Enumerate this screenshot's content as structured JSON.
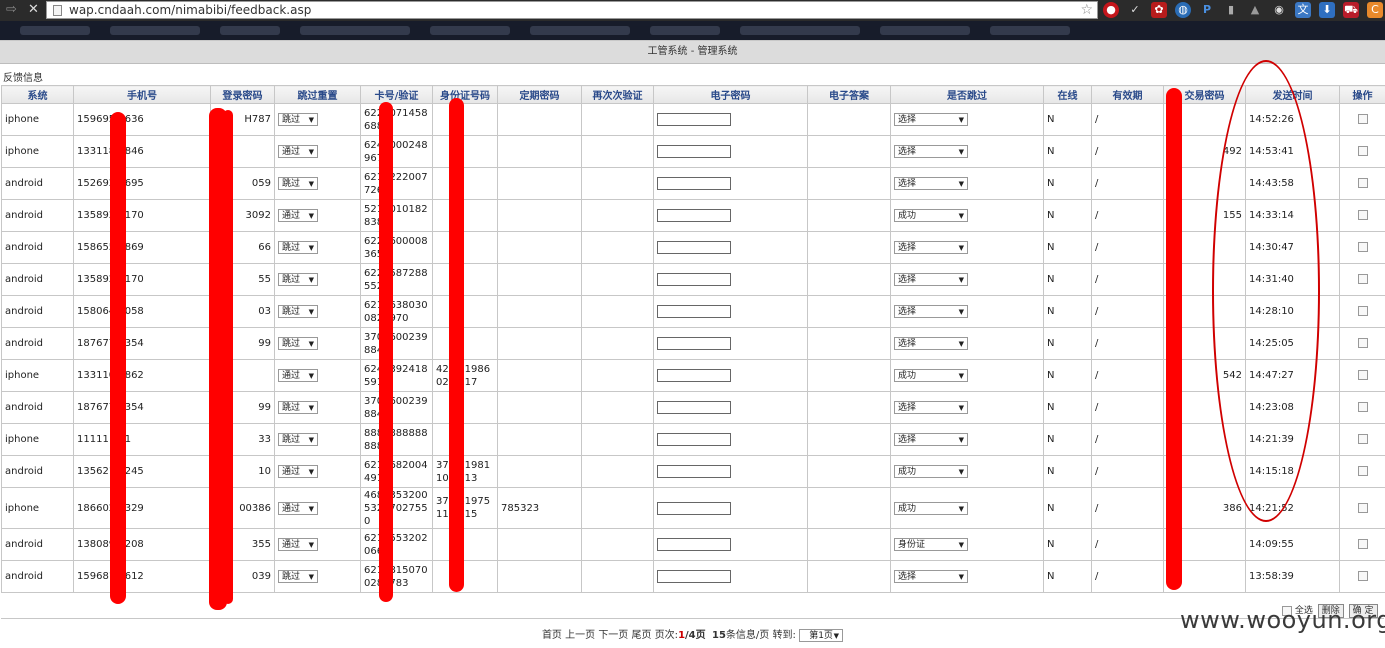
{
  "browser": {
    "url": "wap.cndaah.com/nimabibi/feedback.asp",
    "extensions": [
      "stop-icon",
      "check-icon",
      "paw-icon",
      "firefox-icon",
      "p-icon",
      "bag-icon",
      "globe-icon",
      "translate-icon",
      "download-icon",
      "car-icon",
      "c-icon"
    ]
  },
  "app": {
    "title": "工管系统 - 管理系统",
    "section": "反馈信息"
  },
  "table": {
    "headers": [
      "系统",
      "手机号",
      "登录密码",
      "跳过重置",
      "卡号/验证",
      "身份证号码",
      "定期密码",
      "再次次验证",
      "电子密码",
      "电子答案",
      "是否跳过",
      "在线",
      "有效期",
      "交易密码",
      "发送时间",
      "操作"
    ],
    "rows": [
      {
        "system": "iphone",
        "phone": "159695   636",
        "pwd": "H787",
        "reset": "跳过",
        "card": "622  071458 688",
        "id": "",
        "fixed": "",
        "again": "",
        "answer": "",
        "skip": "选择",
        "online": "N",
        "valid": "/",
        "trade": "",
        "time": "14:52:26"
      },
      {
        "system": "iphone",
        "phone": "133118   846",
        "pwd": "",
        "reset": "通过",
        "card": "624  000248 967",
        "id": "",
        "fixed": "",
        "again": "",
        "answer": "",
        "skip": "选择",
        "online": "N",
        "valid": "/",
        "trade": "492",
        "time": "14:53:41"
      },
      {
        "system": "android",
        "phone": "152692   695",
        "pwd": "059",
        "reset": "跳过",
        "card": "621  222007 726",
        "id": "",
        "fixed": "",
        "again": "",
        "answer": "",
        "skip": "选择",
        "online": "N",
        "valid": "/",
        "trade": "",
        "time": "14:43:58"
      },
      {
        "system": "android",
        "phone": "135892   170",
        "pwd": "3092",
        "reset": "通过",
        "card": "521  010182 838",
        "id": "",
        "fixed": "",
        "again": "",
        "answer": "",
        "skip": "成功",
        "online": "N",
        "valid": "/",
        "trade": "155",
        "time": "14:33:14"
      },
      {
        "system": "android",
        "phone": "158655   869",
        "pwd": "66",
        "reset": "跳过",
        "card": "622  600008 365",
        "id": "",
        "fixed": "",
        "again": "",
        "answer": "",
        "skip": "选择",
        "online": "N",
        "valid": "/",
        "trade": "",
        "time": "14:30:47"
      },
      {
        "system": "android",
        "phone": "135892   170",
        "pwd": "55",
        "reset": "跳过",
        "card": "622  587288 552",
        "id": "",
        "fixed": "",
        "again": "",
        "answer": "",
        "skip": "选择",
        "online": "N",
        "valid": "/",
        "trade": "",
        "time": "14:31:40"
      },
      {
        "system": "android",
        "phone": "158064   058",
        "pwd": "03",
        "reset": "跳过",
        "card": "621  638030 082  970",
        "id": "",
        "fixed": "",
        "again": "",
        "answer": "",
        "skip": "选择",
        "online": "N",
        "valid": "/",
        "trade": "",
        "time": "14:28:10"
      },
      {
        "system": "android",
        "phone": "187677   354",
        "pwd": "99",
        "reset": "跳过",
        "card": "370  600239 884",
        "id": "",
        "fixed": "",
        "again": "",
        "answer": "",
        "skip": "选择",
        "online": "N",
        "valid": "/",
        "trade": "",
        "time": "14:25:05"
      },
      {
        "system": "iphone",
        "phone": "133110   862",
        "pwd": "",
        "reset": "通过",
        "card": "624  392418 591",
        "id": "42   71986 02   017",
        "fixed": "",
        "again": "",
        "answer": "",
        "skip": "成功",
        "online": "N",
        "valid": "/",
        "trade": "542",
        "time": "14:47:27"
      },
      {
        "system": "android",
        "phone": "187677   354",
        "pwd": "99",
        "reset": "跳过",
        "card": "370  600239 884",
        "id": "",
        "fixed": "",
        "again": "",
        "answer": "",
        "skip": "选择",
        "online": "N",
        "valid": "/",
        "trade": "",
        "time": "14:23:08"
      },
      {
        "system": "iphone",
        "phone": "11111   11",
        "pwd": "33",
        "reset": "跳过",
        "card": "888  888888 888",
        "id": "",
        "fixed": "",
        "again": "",
        "answer": "",
        "skip": "选择",
        "online": "N",
        "valid": "/",
        "trade": "",
        "time": "14:21:39"
      },
      {
        "system": "android",
        "phone": "135621   245",
        "pwd": "10",
        "reset": "通过",
        "card": "621  682004 491",
        "id": "37   11981 10   013",
        "fixed": "",
        "again": "",
        "answer": "",
        "skip": "成功",
        "online": "N",
        "valid": "/",
        "trade": "",
        "time": "14:15:18"
      },
      {
        "system": "iphone",
        "phone": "186602   329",
        "pwd": "00386",
        "reset": "通过",
        "card": "468  353200 532  702755 0",
        "id": "37   41975 11   415",
        "fixed": "785323",
        "again": "",
        "answer": "",
        "skip": "成功",
        "online": "N",
        "valid": "/",
        "trade": "386",
        "time": "14:21:52",
        "tall": true
      },
      {
        "system": "android",
        "phone": "138089   208",
        "pwd": "355",
        "reset": "通过",
        "card": "621  553202 066",
        "id": "",
        "fixed": "",
        "again": "",
        "answer": "",
        "skip": "身份证",
        "online": "N",
        "valid": "/",
        "trade": "",
        "time": "14:09:55"
      },
      {
        "system": "android",
        "phone": "159681   612",
        "pwd": "039",
        "reset": "跳过",
        "card": "621  815070 028  783",
        "id": "",
        "fixed": "",
        "again": "",
        "answer": "",
        "skip": "选择",
        "online": "N",
        "valid": "/",
        "trade": "",
        "time": "13:58:39"
      }
    ]
  },
  "bulk": {
    "select_all": "全选",
    "delete": "删除",
    "confirm": "确 定"
  },
  "pager": {
    "first": "首页",
    "prev": "上一页",
    "next": "下一页",
    "last": "尾页",
    "page_label": "页次:",
    "current": "1",
    "total": "/4页",
    "per_page": "15",
    "per_page_suffix": "条信息/页",
    "goto": "转到:",
    "goto_value": "第1页"
  },
  "watermark": "www.wooyun.org",
  "colors": {
    "redaction": "#ff0000",
    "header_text": "#2a4a8a",
    "title_bar": "#dcdcdc"
  }
}
